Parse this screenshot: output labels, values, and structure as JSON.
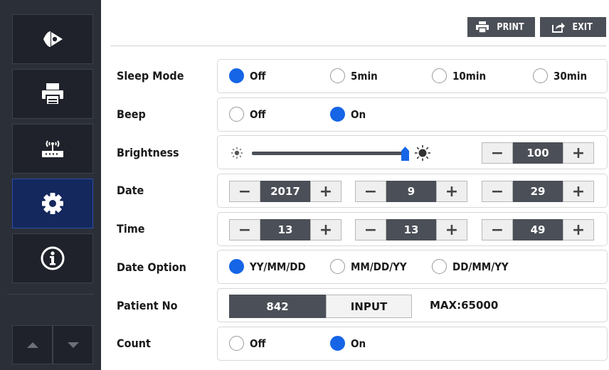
{
  "colors": {
    "accent": "#1565e6",
    "sidebar": "#2b2f38",
    "active_nav": "#14285e",
    "dark_value": "#4b4f57"
  },
  "sidebar": {
    "items": [
      {
        "icon": "play-eye-icon",
        "active": false
      },
      {
        "icon": "printer-icon",
        "active": false
      },
      {
        "icon": "wireless-router-icon",
        "active": false
      },
      {
        "icon": "gear-icon",
        "active": true
      },
      {
        "icon": "info-icon",
        "active": false
      }
    ],
    "arrows": [
      "chevron-up-icon",
      "chevron-down-icon"
    ]
  },
  "toolbar": {
    "print_label": "PRINT",
    "exit_label": "EXIT"
  },
  "settings": {
    "sleep_mode": {
      "label": "Sleep Mode",
      "options": [
        "Off",
        "5min",
        "10min",
        "30min"
      ],
      "selected": "Off"
    },
    "beep": {
      "label": "Beep",
      "options": [
        "Off",
        "On"
      ],
      "selected": "On"
    },
    "brightness": {
      "label": "Brightness",
      "value": "100",
      "level": 1.0
    },
    "date": {
      "label": "Date",
      "year": "2017",
      "month": "9",
      "day": "29"
    },
    "time": {
      "label": "Time",
      "hour": "13",
      "minute": "13",
      "second": "49"
    },
    "date_option": {
      "label": "Date Option",
      "options": [
        "YY/MM/DD",
        "MM/DD/YY",
        "DD/MM/YY"
      ],
      "selected": "YY/MM/DD"
    },
    "patient_no": {
      "label": "Patient No",
      "value": "842",
      "input_label": "INPUT",
      "max_text": "MAX:65000"
    },
    "count": {
      "label": "Count",
      "options": [
        "Off",
        "On"
      ],
      "selected": "On"
    }
  }
}
